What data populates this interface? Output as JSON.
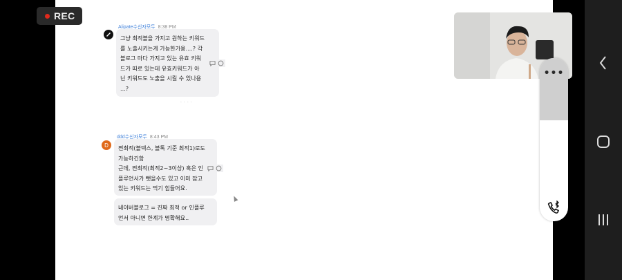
{
  "recording": {
    "label": "REC"
  },
  "chat": {
    "messages": [
      {
        "sender": "Alipate",
        "sender_suffix": "수신자모두",
        "time": "8:38 PM",
        "bubbles": [
          {
            "lines": [
              "그냥 최적블을 가지고 원하는 키워드",
              "를 노출시키는게 가능한가용....? 각",
              "블로그 마다 가지고 있는 유효 키워",
              "드가 따로 있는데  유효키워드가 아",
              "닌 키워드도 노출을 시킬 수 있나용",
              "...?"
            ]
          }
        ]
      },
      {
        "sender": "ddd",
        "sender_suffix": "수신자모두",
        "time": "8:43 PM",
        "avatar_letter": "D",
        "bubbles": [
          {
            "lines": [
              "찐최적(블덱스, 블톡 기준 최적1)로도",
              "가능하긴함",
              "근데, 찐최적(최적2~3이상) 혹은 인",
              "플루언서가 뺏을수도 있고 이미 잡고",
              "있는 키워드는 먹기 힘들어요."
            ]
          },
          {
            "lines": [
              "네이버블로그 = 진짜 최적 or 인플루",
              "언서 아니면 한계가 명확해요.."
            ]
          }
        ]
      }
    ]
  },
  "video_panel": {
    "more_label": "•••"
  },
  "colors": {
    "accent_name": "#3d7fd9",
    "rec_dot": "#e0291c",
    "bubble_bg": "#f0f0f2"
  },
  "icons": [
    "record-dot-icon",
    "reply-icon",
    "reaction-icon",
    "more-icon",
    "phone-bluetooth-icon",
    "back-icon",
    "home-icon",
    "recents-icon"
  ]
}
